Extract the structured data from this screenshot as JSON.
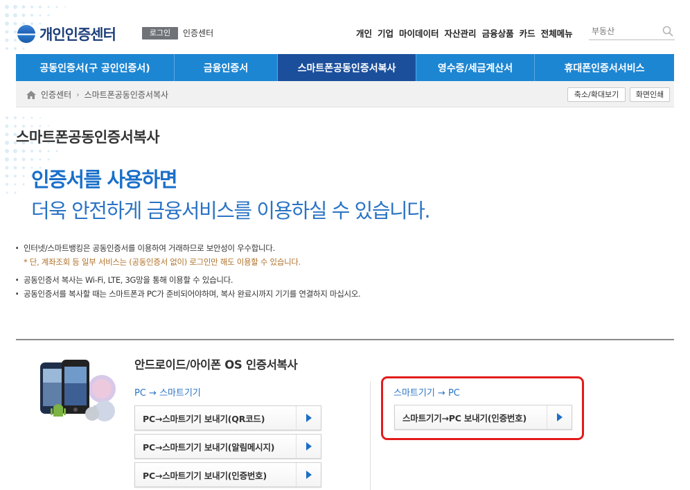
{
  "header": {
    "logo_text": "개인인증센터",
    "login_label": "로그인",
    "center_label": "인증센터",
    "topnav": [
      "개인",
      "기업",
      "마이데이터",
      "자산관리",
      "금융상품",
      "카드",
      "전체메뉴"
    ],
    "search_placeholder": "부동산"
  },
  "gnb": [
    "공동인증서(구 공인인증서)",
    "금융인증서",
    "스마트폰공동인증서복사",
    "영수증/세금계산서",
    "휴대폰인증서서비스"
  ],
  "gnb_active_index": 2,
  "breadcrumb": {
    "home": "인증센터",
    "current": "스마트폰공동인증서복사"
  },
  "tools": {
    "zoom": "축소/확대보기",
    "print": "화면인쇄"
  },
  "page_title": "스마트폰공동인증서복사",
  "headline": {
    "line1": "인증서를 사용하면",
    "line2": "더욱 안전하게 금융서비스를 이용하실 수 있습니다."
  },
  "notes": {
    "n1": "인터넷/스마트뱅킹은 공동인증서를 이용하여 거래하므로 보안성이 우수합니다.",
    "n1_sub": "* 단, 계좌조회 등 일부 서비스는 (공동인증서 없이) 로그인만 해도 이용할 수 있습니다.",
    "n2": "공동인증서 복사는 Wi-Fi, LTE, 3G망을 통해 이용할 수 있습니다.",
    "n3": "공동인증서를 복사할 때는 스마트폰과 PC가 준비되어야하며, 복사 완료시까지 기기를 연결하지 마십시오."
  },
  "copy_section": {
    "title": "안드로이드/아이폰 OS 인증서복사",
    "pc_to_phone": {
      "label": "PC → 스마트기기",
      "buttons": [
        "PC→스마트기기 보내기(QR코드)",
        "PC→스마트기기 보내기(알림메시지)",
        "PC→스마트기기 보내기(인증번호)"
      ]
    },
    "phone_to_pc": {
      "label": "스마트기기 → PC",
      "buttons": [
        "스마트기기→PC 보내기(인증번호)"
      ]
    }
  },
  "colors": {
    "gnb": "#1d86d3",
    "gnb_active": "#1b4f9c",
    "accent_blue": "#1a6fc9",
    "highlight": "#e21b1b",
    "note_sub": "#b0722a"
  }
}
